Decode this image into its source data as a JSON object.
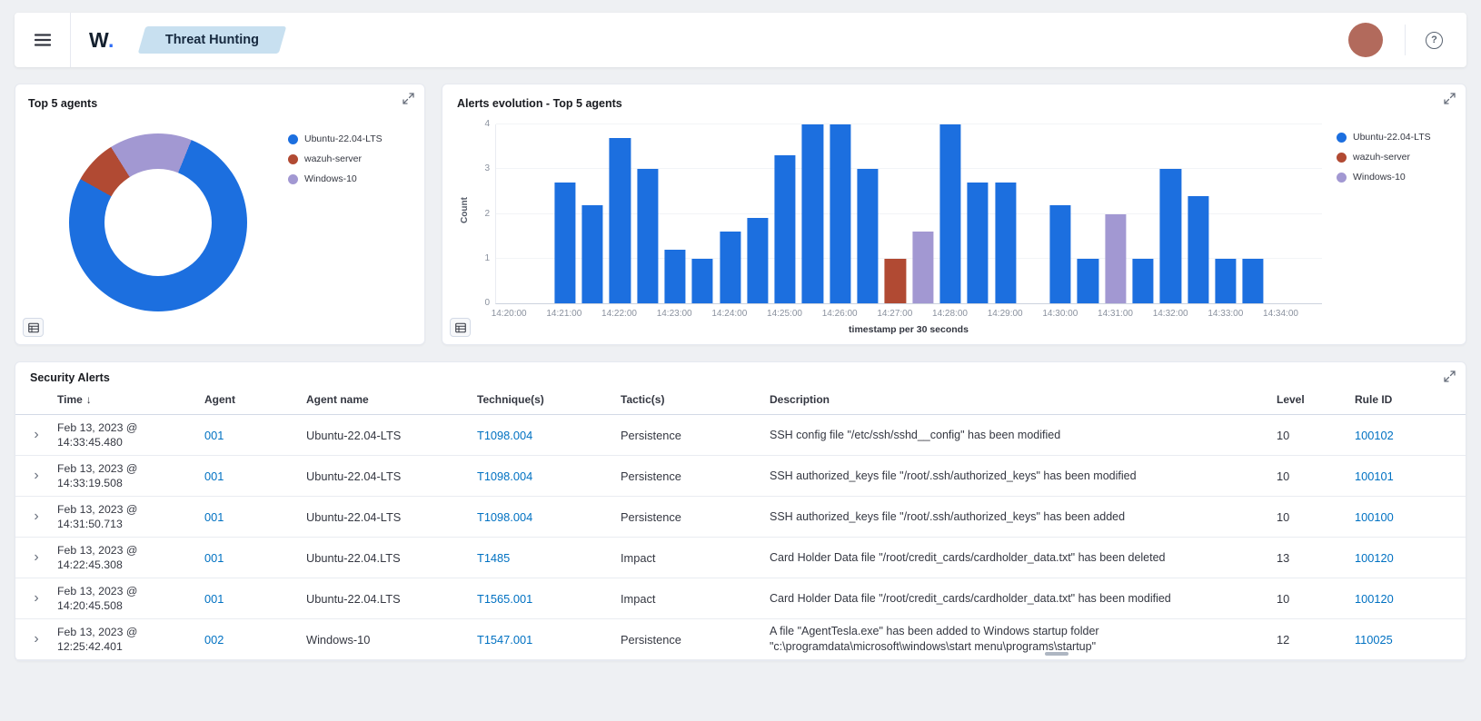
{
  "header": {
    "logo_w": "W",
    "logo_dot": ".",
    "breadcrumb": "Threat Hunting",
    "help_label": "?"
  },
  "colors": {
    "ubuntu_blue": "#1c6fdf",
    "wazuh_red": "#b14a33",
    "windows_purple": "#a298d2",
    "link_blue": "#0071c2",
    "avatar": "#b26a5c",
    "breadcrumb_bg": "#c8e0f0"
  },
  "alerts_panel": {
    "title": "Security Alerts",
    "columns": [
      "Time",
      "Agent",
      "Agent name",
      "Technique(s)",
      "Tactic(s)",
      "Description",
      "Level",
      "Rule ID"
    ],
    "sort_column": "Time",
    "sort_direction": "desc",
    "rows": [
      {
        "time1": "Feb 13, 2023 @",
        "time2": "14:33:45.480",
        "agent": "001",
        "agent_name": "Ubuntu-22.04-LTS",
        "technique": "T1098.004",
        "tactic": "Persistence",
        "description": "SSH config file \"/etc/ssh/sshd__config\" has been modified",
        "level": "10",
        "rule_id": "100102"
      },
      {
        "time1": "Feb 13, 2023 @",
        "time2": "14:33:19.508",
        "agent": "001",
        "agent_name": "Ubuntu-22.04-LTS",
        "technique": "T1098.004",
        "tactic": "Persistence",
        "description": "SSH authorized_keys file \"/root/.ssh/authorized_keys\" has been modified",
        "level": "10",
        "rule_id": "100101"
      },
      {
        "time1": "Feb 13, 2023 @",
        "time2": "14:31:50.713",
        "agent": "001",
        "agent_name": "Ubuntu-22.04-LTS",
        "technique": "T1098.004",
        "tactic": "Persistence",
        "description": "SSH authorized_keys file \"/root/.ssh/authorized_keys\" has been added",
        "level": "10",
        "rule_id": "100100"
      },
      {
        "time1": "Feb 13, 2023 @",
        "time2": "14:22:45.308",
        "agent": "001",
        "agent_name": "Ubuntu-22.04.LTS",
        "technique": "T1485",
        "tactic": "Impact",
        "description": "Card Holder Data file \"/root/credit_cards/cardholder_data.txt\" has been deleted",
        "level": "13",
        "rule_id": "100120"
      },
      {
        "time1": "Feb 13, 2023 @",
        "time2": "14:20:45.508",
        "agent": "001",
        "agent_name": "Ubuntu-22.04.LTS",
        "technique": "T1565.001",
        "tactic": "Impact",
        "description": "Card Holder Data file \"/root/credit_cards/cardholder_data.txt\" has been modified",
        "level": "10",
        "rule_id": "100120"
      },
      {
        "time1": "Feb 13, 2023 @",
        "time2": "12:25:42.401",
        "agent": "002",
        "agent_name": "Windows-10",
        "technique": "T1547.001",
        "tactic": "Persistence",
        "description": "A file \"AgentTesla.exe\" has been added to Windows startup folder \"c:\\programdata\\microsoft\\windows\\start menu\\programs\\startup\"",
        "level": "12",
        "rule_id": "110025"
      }
    ]
  },
  "chart_data": [
    {
      "type": "pie",
      "donut": true,
      "title": "Top 5 agents",
      "labels": [
        "Ubuntu-22.04-LTS",
        "wazuh-server",
        "Windows-10"
      ],
      "values_pct": [
        77,
        8,
        15
      ],
      "colors": [
        "#1c6fdf",
        "#b14a33",
        "#a298d2"
      ],
      "start_angle_deg": 22,
      "legend_position": "right"
    },
    {
      "type": "bar",
      "title": "Alerts evolution - Top 5 agents",
      "xlabel": "timestamp per 30 seconds",
      "ylabel": "Count",
      "ylim": [
        0,
        4
      ],
      "yticks": [
        0,
        1,
        2,
        3,
        4
      ],
      "xticks": [
        "14:20:00",
        "14:21:00",
        "14:22:00",
        "14:23:00",
        "14:24:00",
        "14:25:00",
        "14:26:00",
        "14:27:00",
        "14:28:00",
        "14:29:00",
        "14:30:00",
        "14:31:00",
        "14:32:00",
        "14:33:00",
        "14:34:00"
      ],
      "x_domain": [
        "14:19:45",
        "14:34:45"
      ],
      "legend_position": "right",
      "legend": [
        {
          "label": "Ubuntu-22.04-LTS",
          "color": "#1c6fdf"
        },
        {
          "label": "wazuh-server",
          "color": "#b14a33"
        },
        {
          "label": "Windows-10",
          "color": "#a298d2"
        }
      ],
      "bars": [
        {
          "x": "14:21:00",
          "y": 2.7,
          "series": "Ubuntu-22.04-LTS"
        },
        {
          "x": "14:21:30",
          "y": 2.2,
          "series": "Ubuntu-22.04-LTS"
        },
        {
          "x": "14:22:00",
          "y": 3.7,
          "series": "Ubuntu-22.04-LTS"
        },
        {
          "x": "14:22:30",
          "y": 3.0,
          "series": "Ubuntu-22.04-LTS"
        },
        {
          "x": "14:23:00",
          "y": 1.2,
          "series": "Ubuntu-22.04-LTS"
        },
        {
          "x": "14:23:30",
          "y": 1.0,
          "series": "Ubuntu-22.04-LTS"
        },
        {
          "x": "14:24:00",
          "y": 1.6,
          "series": "Ubuntu-22.04-LTS"
        },
        {
          "x": "14:24:30",
          "y": 1.9,
          "series": "Ubuntu-22.04-LTS"
        },
        {
          "x": "14:25:00",
          "y": 3.3,
          "series": "Ubuntu-22.04-LTS"
        },
        {
          "x": "14:25:30",
          "y": 4.0,
          "series": "Ubuntu-22.04-LTS"
        },
        {
          "x": "14:26:00",
          "y": 4.0,
          "series": "Ubuntu-22.04-LTS"
        },
        {
          "x": "14:26:30",
          "y": 3.0,
          "series": "Ubuntu-22.04-LTS"
        },
        {
          "x": "14:27:00",
          "y": 1.0,
          "series": "wazuh-server"
        },
        {
          "x": "14:27:30",
          "y": 1.6,
          "series": "Windows-10"
        },
        {
          "x": "14:28:00",
          "y": 4.0,
          "series": "Ubuntu-22.04-LTS"
        },
        {
          "x": "14:28:30",
          "y": 2.7,
          "series": "Ubuntu-22.04-LTS"
        },
        {
          "x": "14:29:00",
          "y": 2.7,
          "series": "Ubuntu-22.04-LTS"
        },
        {
          "x": "14:30:00",
          "y": 2.2,
          "series": "Ubuntu-22.04-LTS"
        },
        {
          "x": "14:30:30",
          "y": 1.0,
          "series": "Ubuntu-22.04-LTS"
        },
        {
          "x": "14:31:00",
          "y": 2.0,
          "series": "Windows-10"
        },
        {
          "x": "14:31:30",
          "y": 1.0,
          "series": "Ubuntu-22.04-LTS"
        },
        {
          "x": "14:32:00",
          "y": 3.0,
          "series": "Ubuntu-22.04-LTS"
        },
        {
          "x": "14:32:30",
          "y": 2.4,
          "series": "Ubuntu-22.04-LTS"
        },
        {
          "x": "14:33:00",
          "y": 1.0,
          "series": "Ubuntu-22.04-LTS"
        },
        {
          "x": "14:33:30",
          "y": 1.0,
          "series": "Ubuntu-22.04-LTS"
        }
      ]
    }
  ]
}
